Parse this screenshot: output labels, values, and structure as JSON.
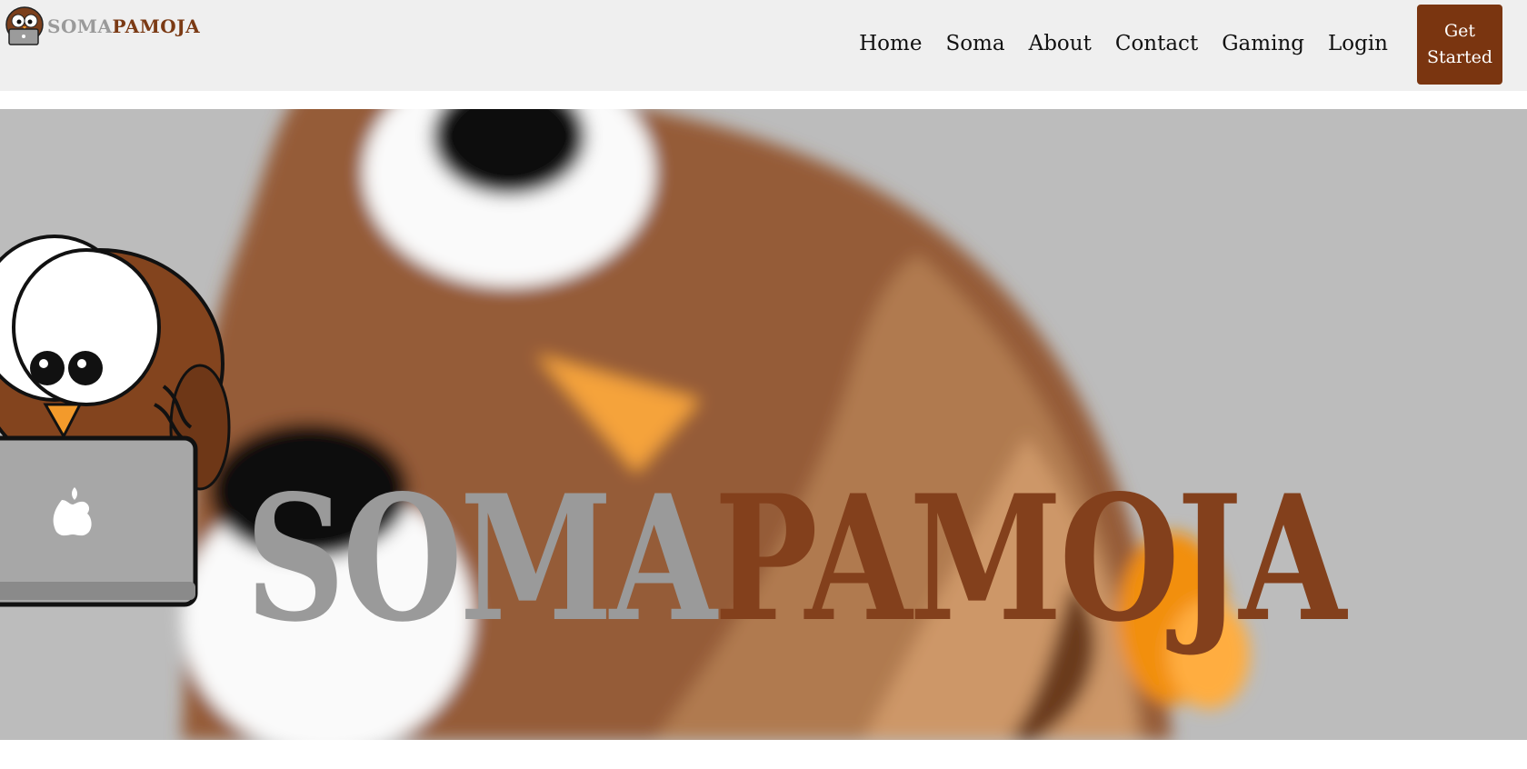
{
  "brand": {
    "logo_icon": "owl-laptop-logo",
    "name_part1": "SOMA",
    "name_part2": "PAMOJA"
  },
  "nav": {
    "items": [
      {
        "label": "Home"
      },
      {
        "label": "Soma"
      },
      {
        "label": "About"
      },
      {
        "label": "Contact"
      },
      {
        "label": "Gaming"
      },
      {
        "label": "Login"
      }
    ],
    "cta_label": "Get Started"
  },
  "hero": {
    "title_part1": "SOMA",
    "title_part2": "PAMOJA",
    "illustration": "owl-with-laptop"
  },
  "colors": {
    "navbar_bg": "#efefef",
    "brand_brown": "#7a3510",
    "brand_gray": "#9a9a9a",
    "hero_bg": "#bcbcbc"
  }
}
